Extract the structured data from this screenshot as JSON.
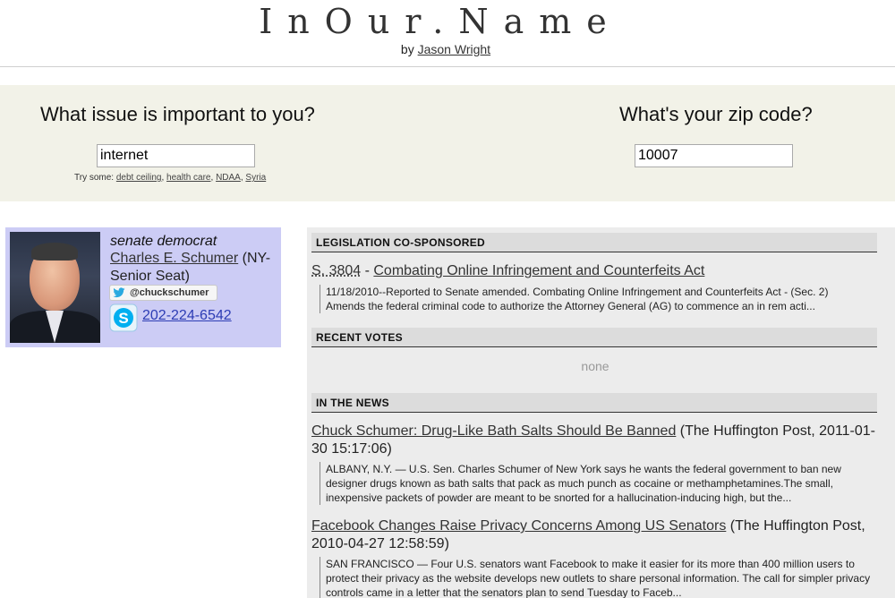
{
  "header": {
    "title": "InOur.Name",
    "by": "by",
    "author": "Jason Wright"
  },
  "search": {
    "issue_question": "What issue is important to you?",
    "issue_value": "internet",
    "zip_question": "What's your zip code?",
    "zip_value": "10007",
    "try_label": "Try some:",
    "suggestions": [
      "debt ceiling",
      "health care",
      "NDAA",
      "Syria"
    ]
  },
  "rep": {
    "role": "senate democrat",
    "name": "Charles E. Schumer",
    "seat": "(NY-Senior Seat)",
    "twitter_handle": "@chuckschumer",
    "phone": "202-224-6542",
    "icons": {
      "twitter": "twitter-bird-icon",
      "skype": "skype-icon"
    }
  },
  "legislation": {
    "header": "LEGISLATION CO-SPONSORED",
    "bill_number": "S. 3804",
    "separator": " - ",
    "bill_title": "Combating Online Infringement and Counterfeits Act",
    "summary_line1": "11/18/2010--Reported to Senate amended. Combating Online Infringement and Counterfeits Act - (Sec. 2)",
    "summary_line2": "Amends the federal criminal code to authorize the Attorney General (AG) to commence an in rem acti..."
  },
  "votes": {
    "header": "RECENT VOTES",
    "empty_text": "none"
  },
  "news": {
    "header": "IN THE NEWS",
    "items": [
      {
        "title": "Chuck Schumer: Drug-Like Bath Salts Should Be Banned",
        "meta": "(The Huffington Post, 2011-01-30 15:17:06)",
        "excerpt": "ALBANY, N.Y. — U.S. Sen. Charles Schumer of New York says he wants the federal government to ban new designer drugs known as bath salts that pack as much punch as cocaine or methamphetamines.The small, inexpensive packets of powder are meant to be snorted for a hallucination-inducing high, but the..."
      },
      {
        "title": "Facebook Changes Raise Privacy Concerns Among US Senators",
        "meta": "(The Huffington Post, 2010-04-27 12:58:59)",
        "excerpt": "SAN FRANCISCO — Four U.S. senators want Facebook to make it easier for its more than 400 million users to protect their privacy as the website develops new outlets to share personal information. The call for simpler privacy controls came in a letter that the senators plan to send Tuesday to Faceb..."
      }
    ]
  },
  "colors": {
    "band_bg": "#f2f2e8",
    "rep_card_bg": "#ccccf5",
    "panel_bg": "#ececec",
    "phone_link": "#2c3cb4"
  }
}
